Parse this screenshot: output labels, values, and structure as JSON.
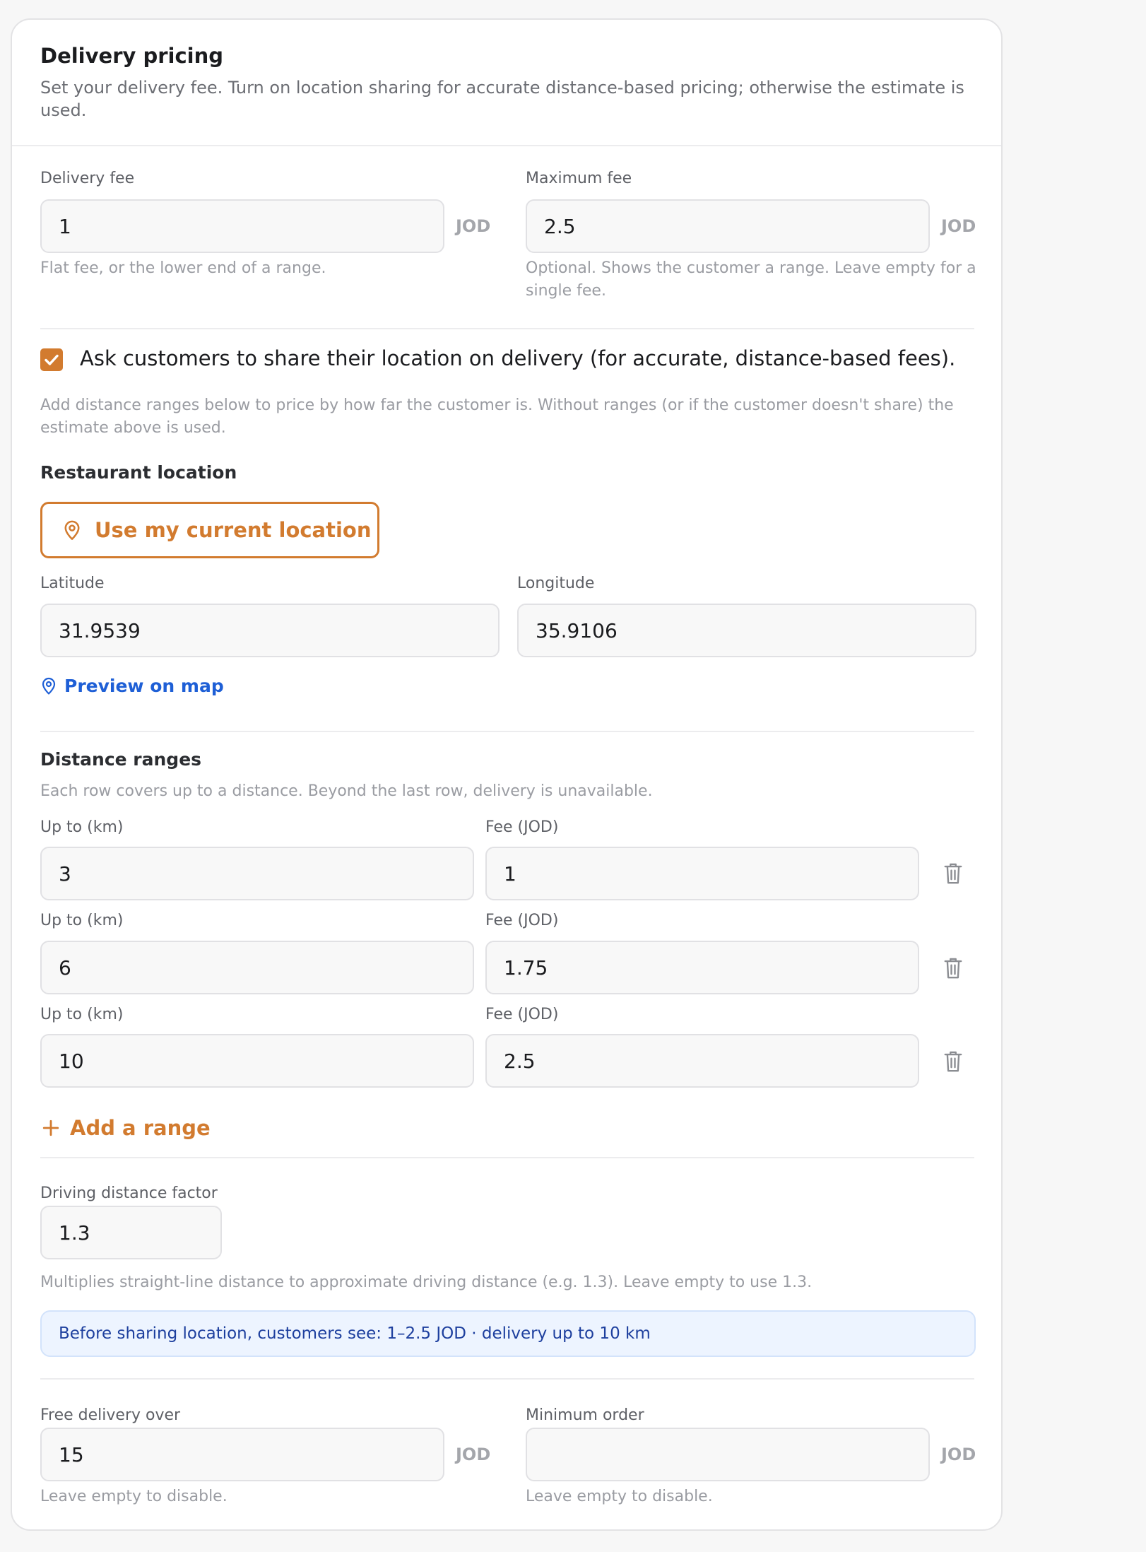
{
  "header": {
    "title": "Delivery pricing",
    "description": "Set your delivery fee. Turn on location sharing for accurate distance-based pricing; otherwise the estimate is used."
  },
  "fees": {
    "delivery_fee_label": "Delivery fee",
    "delivery_fee_value": "1",
    "delivery_fee_unit": "JOD",
    "delivery_fee_hint": "Flat fee, or the lower end of a range.",
    "max_fee_label": "Maximum fee",
    "max_fee_value": "2.5",
    "max_fee_unit": "JOD",
    "max_fee_hint": "Optional. Shows the customer a range. Leave empty for a single fee."
  },
  "location_sharing": {
    "checked": true,
    "label": "Ask customers to share their location on delivery (for accurate, distance-based fees).",
    "hint": "Add distance ranges below to price by how far the customer is. Without ranges (or if the customer doesn't share) the estimate above is used."
  },
  "restaurant_location": {
    "title": "Restaurant location",
    "use_location_button": "Use my current location",
    "latitude_label": "Latitude",
    "latitude_value": "31.9539",
    "longitude_label": "Longitude",
    "longitude_value": "35.9106",
    "preview_link": "Preview on map"
  },
  "distance_ranges": {
    "title": "Distance ranges",
    "hint": "Each row covers up to a distance. Beyond the last row, delivery is unavailable.",
    "rows": [
      {
        "distance_label": "Up to (km)",
        "distance_value": "3",
        "fee_label": "Fee (JOD)",
        "fee_value": "1"
      },
      {
        "distance_label": "Up to (km)",
        "distance_value": "6",
        "fee_label": "Fee (JOD)",
        "fee_value": "1.75"
      },
      {
        "distance_label": "Up to (km)",
        "distance_value": "10",
        "fee_label": "Fee (JOD)",
        "fee_value": "2.5"
      }
    ],
    "add_button": "Add a range"
  },
  "driving_factor": {
    "label": "Driving distance factor",
    "value": "1.3",
    "hint": "Multiplies straight-line distance to approximate driving distance (e.g. 1.3). Leave empty to use 1.3."
  },
  "info_banner": "Before sharing location, customers see: 1–2.5 JOD · delivery up to 10 km",
  "thresholds": {
    "free_delivery_label": "Free delivery over",
    "free_delivery_value": "15",
    "free_delivery_unit": "JOD",
    "free_delivery_hint": "Leave empty to disable.",
    "min_order_label": "Minimum order",
    "min_order_value": "",
    "min_order_unit": "JOD",
    "min_order_hint": "Leave empty to disable."
  },
  "colors": {
    "accent": "#d27b2f",
    "link": "#1e5fd6",
    "info_bg": "#edf4ff"
  },
  "icons": {
    "checkbox": "check-icon",
    "location": "map-pin-icon",
    "delete": "trash-icon",
    "add": "plus-icon"
  }
}
